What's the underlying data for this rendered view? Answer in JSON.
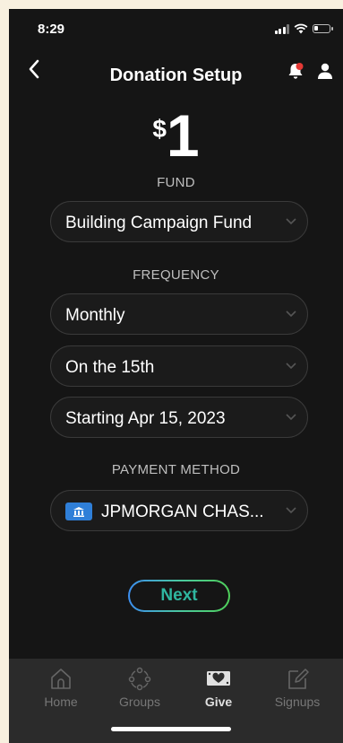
{
  "status_bar": {
    "time": "8:29"
  },
  "header": {
    "title": "Donation Setup"
  },
  "amount": {
    "symbol": "$",
    "value": "1"
  },
  "fund": {
    "label": "FUND",
    "selected": "Building Campaign Fund"
  },
  "frequency": {
    "label": "FREQUENCY",
    "interval": "Monthly",
    "day": "On the 15th",
    "start": "Starting Apr 15, 2023"
  },
  "payment": {
    "label": "PAYMENT METHOD",
    "selected": "JPMORGAN CHAS..."
  },
  "next_button": {
    "label": "Next"
  },
  "tabbar": {
    "items": [
      {
        "label": "Home",
        "icon": "home-icon",
        "active": false
      },
      {
        "label": "Groups",
        "icon": "groups-icon",
        "active": false
      },
      {
        "label": "Give",
        "icon": "give-icon",
        "active": true
      },
      {
        "label": "Signups",
        "icon": "signups-icon",
        "active": false
      }
    ]
  },
  "colors": {
    "background": "#151515",
    "accent_blue": "#3c8ef0",
    "accent_green": "#4fd05a",
    "next_text": "#2fb6a0",
    "notification_dot": "#e53935"
  }
}
